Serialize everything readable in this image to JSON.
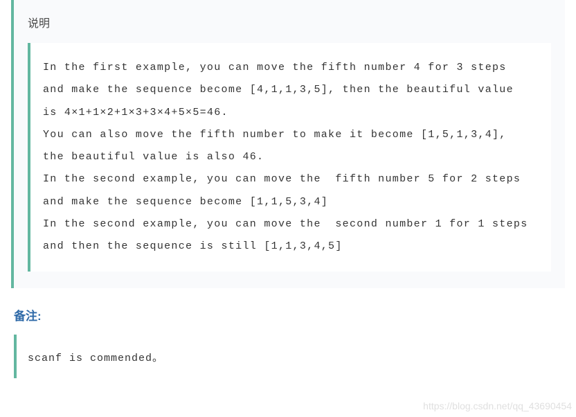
{
  "section": {
    "title": "说明",
    "content": "In the first example, you can move the fifth number 4 for 3 steps and make the sequence become [4,1,1,3,5], then the beautiful value is 4×1+1×2+1×3+3×4+5×5=46.\nYou can also move the fifth number to make it become [1,5,1,3,4], the beautiful value is also 46.\nIn the second example, you can move the  fifth number 5 for 2 steps and make the sequence become [1,1,5,3,4]\nIn the second example, you can move the  second number 1 for 1 steps and then the sequence is still [1,1,3,4,5]"
  },
  "remark": {
    "title": "备注:",
    "content": "scanf is commended。"
  },
  "watermark": "https://blog.csdn.net/qq_43690454"
}
